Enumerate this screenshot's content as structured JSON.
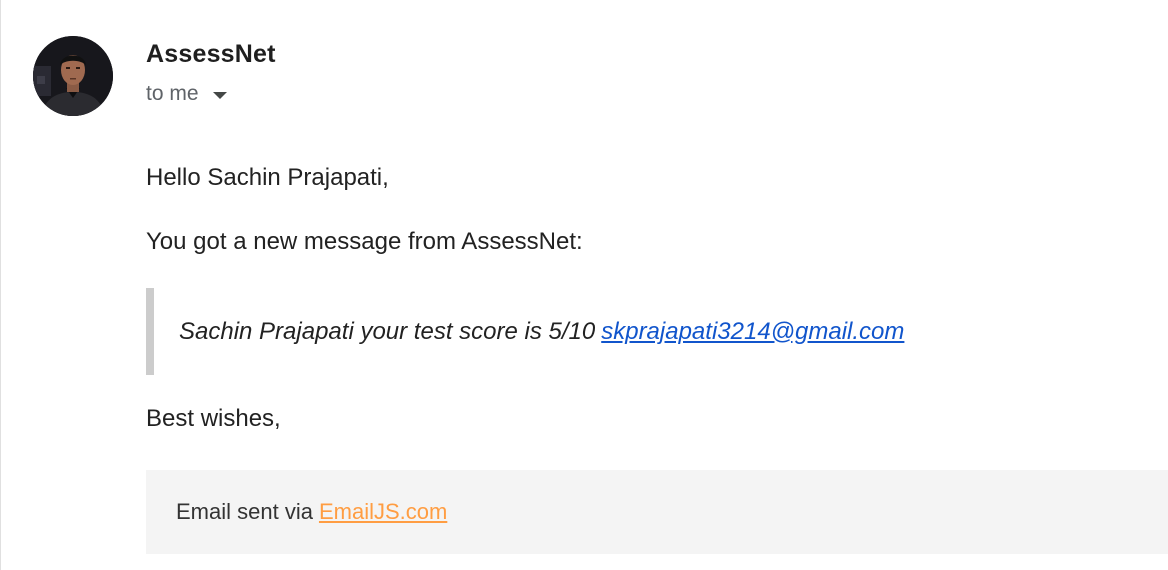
{
  "header": {
    "sender_name": "AssessNet",
    "recipient": "to me",
    "avatar_icon": "profile-photo"
  },
  "message": {
    "greeting": "Hello Sachin Prajapati,",
    "intro": "You got a new message from AssessNet:",
    "quote_text": "Sachin Prajapati your test score is 5/10",
    "quote_email": "skprajapati3214@gmail.com",
    "closing": "Best wishes,"
  },
  "footer": {
    "prefix": "Email sent via",
    "link_text": "EmailJS.com"
  },
  "colors": {
    "link_blue": "#1155cc",
    "footer_link_orange": "#ff9d42",
    "quote_border": "#cccccc",
    "footer_background": "#f4f4f4"
  }
}
